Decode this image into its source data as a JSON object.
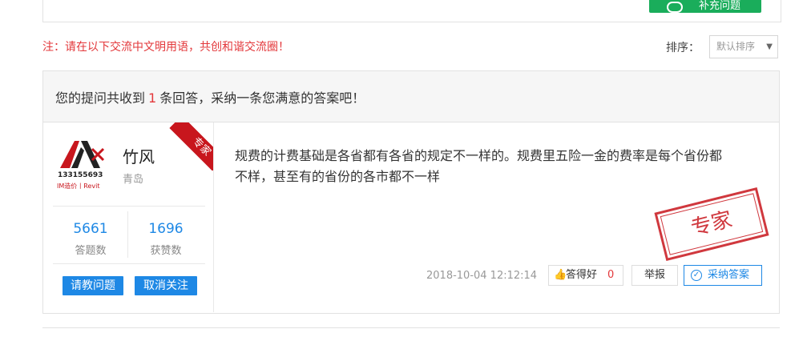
{
  "toolbar": {
    "supplement_label": "补充问题"
  },
  "notice": "注：请在以下交流中文明用语，共创和谐交流圈！",
  "sort": {
    "label": "排序：",
    "selected": "默认排序"
  },
  "answers_header": {
    "prefix": "您的提问共收到",
    "count": "1",
    "suffix": "条回答，采纳一条您满意的答案吧！"
  },
  "answer": {
    "user": {
      "name": "竹风",
      "city": "青岛",
      "badge": "专家",
      "avatar_line1": "133155693",
      "avatar_line2": "IM造价丨Revit",
      "stats": [
        {
          "value": "5661",
          "label": "答题数"
        },
        {
          "value": "1696",
          "label": "获赞数"
        }
      ],
      "ask_button": "请教问题",
      "unfollow_button": "取消关注"
    },
    "text": "规费的计费基础是各省都有各省的规定不一样的。规费里五险一金的费率是每个省份都不样，甚至有的省份的各市都不一样",
    "stamp": "专家",
    "time": "2018-10-04 12:12:14",
    "good_label": "答得好",
    "good_count": "0",
    "report_label": "举报",
    "accept_label": "采纳答案"
  },
  "colors": {
    "accent_blue": "#1e88e5",
    "alert_red": "#e3383b",
    "green": "#1aad5b",
    "badge_red": "#c8161d"
  }
}
